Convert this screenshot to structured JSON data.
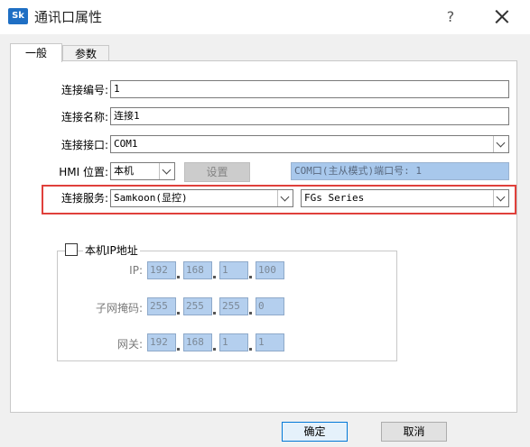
{
  "window": {
    "icon_text": "Sk",
    "title": "通讯口属性",
    "help_glyph": "?"
  },
  "tabs": [
    {
      "label": "一般",
      "active": true
    },
    {
      "label": "参数",
      "active": false
    }
  ],
  "form": {
    "conn_number_label": "连接编号:",
    "conn_number_value": "1",
    "conn_name_label": "连接名称:",
    "conn_name_value": "连接1",
    "conn_port_label": "连接接口:",
    "conn_port_value": "COM1",
    "hmi_pos_label": "HMI 位置:",
    "hmi_pos_value": "本机",
    "settings_button": "设置",
    "port_info": "COM口(主从模式)端口号: 1",
    "service_label": "连接服务:",
    "service_value": "Samkoon(显控)",
    "series_value": "FGs Series"
  },
  "ip_group": {
    "title": "本机IP地址",
    "checked": false,
    "ip_label": "IP:",
    "ip": [
      "192",
      "168",
      "1",
      "100"
    ],
    "mask_label": "子网掩码:",
    "mask": [
      "255",
      "255",
      "255",
      "0"
    ],
    "gateway_label": "网关:",
    "gateway": [
      "192",
      "168",
      "1",
      "1"
    ]
  },
  "buttons": {
    "ok": "确定",
    "cancel": "取消"
  },
  "colors": {
    "highlight": "#e0403b",
    "disabled_field": "#a8c8ec"
  }
}
